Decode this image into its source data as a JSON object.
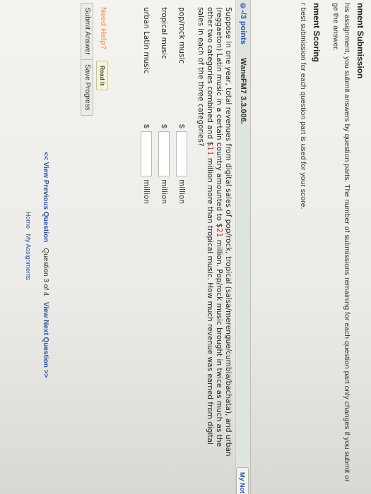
{
  "submission": {
    "title": "nment Submission",
    "text1": "his assignment, you submit answers by question parts. The number of submissions remaining for each question part only changes if you submit or",
    "text2": "ge the answer."
  },
  "scoring": {
    "title": "nment Scoring",
    "text": "r best submission for each question part is used for your score."
  },
  "question": {
    "points": "-/3 points",
    "source": "WaneFM7 3.3.006.",
    "notes_label": "My Not",
    "text": "Suppose in one year, total revenues from digital sales of pop/rock, tropical (salsa/merengue/cumbia/bachata), and urban (reggaeton) Latin music in a certain country amounted to $21 million. Pop/rock music brought in twice as much as the other two categories combined and $11 million more than tropical music. How much revenue was earned from digital sales in each of the three categories?",
    "highlight_values": [
      "21",
      "11"
    ],
    "answers": [
      {
        "label": "pop/rock music",
        "currency": "$",
        "value": "",
        "unit": "million"
      },
      {
        "label": "tropical music",
        "currency": "$",
        "value": "",
        "unit": "million"
      },
      {
        "label": "urban Latin music",
        "currency": "$",
        "value": "",
        "unit": "million"
      }
    ]
  },
  "help": {
    "label": "Need Help?",
    "read_it": "Read It"
  },
  "actions": {
    "submit": "Submit Answer",
    "save": "Save Progress"
  },
  "navigation": {
    "prev": "<< View Previous Question",
    "position": "Question 3 of 4",
    "next": "View Next Question >>"
  },
  "footer": {
    "home": "Home",
    "my_assignments": "My Assignments"
  },
  "colors": {
    "link": "#2b57a8",
    "highlight": "#c0392b",
    "need_help": "#f0a877",
    "header_band": "#dfe4de"
  }
}
